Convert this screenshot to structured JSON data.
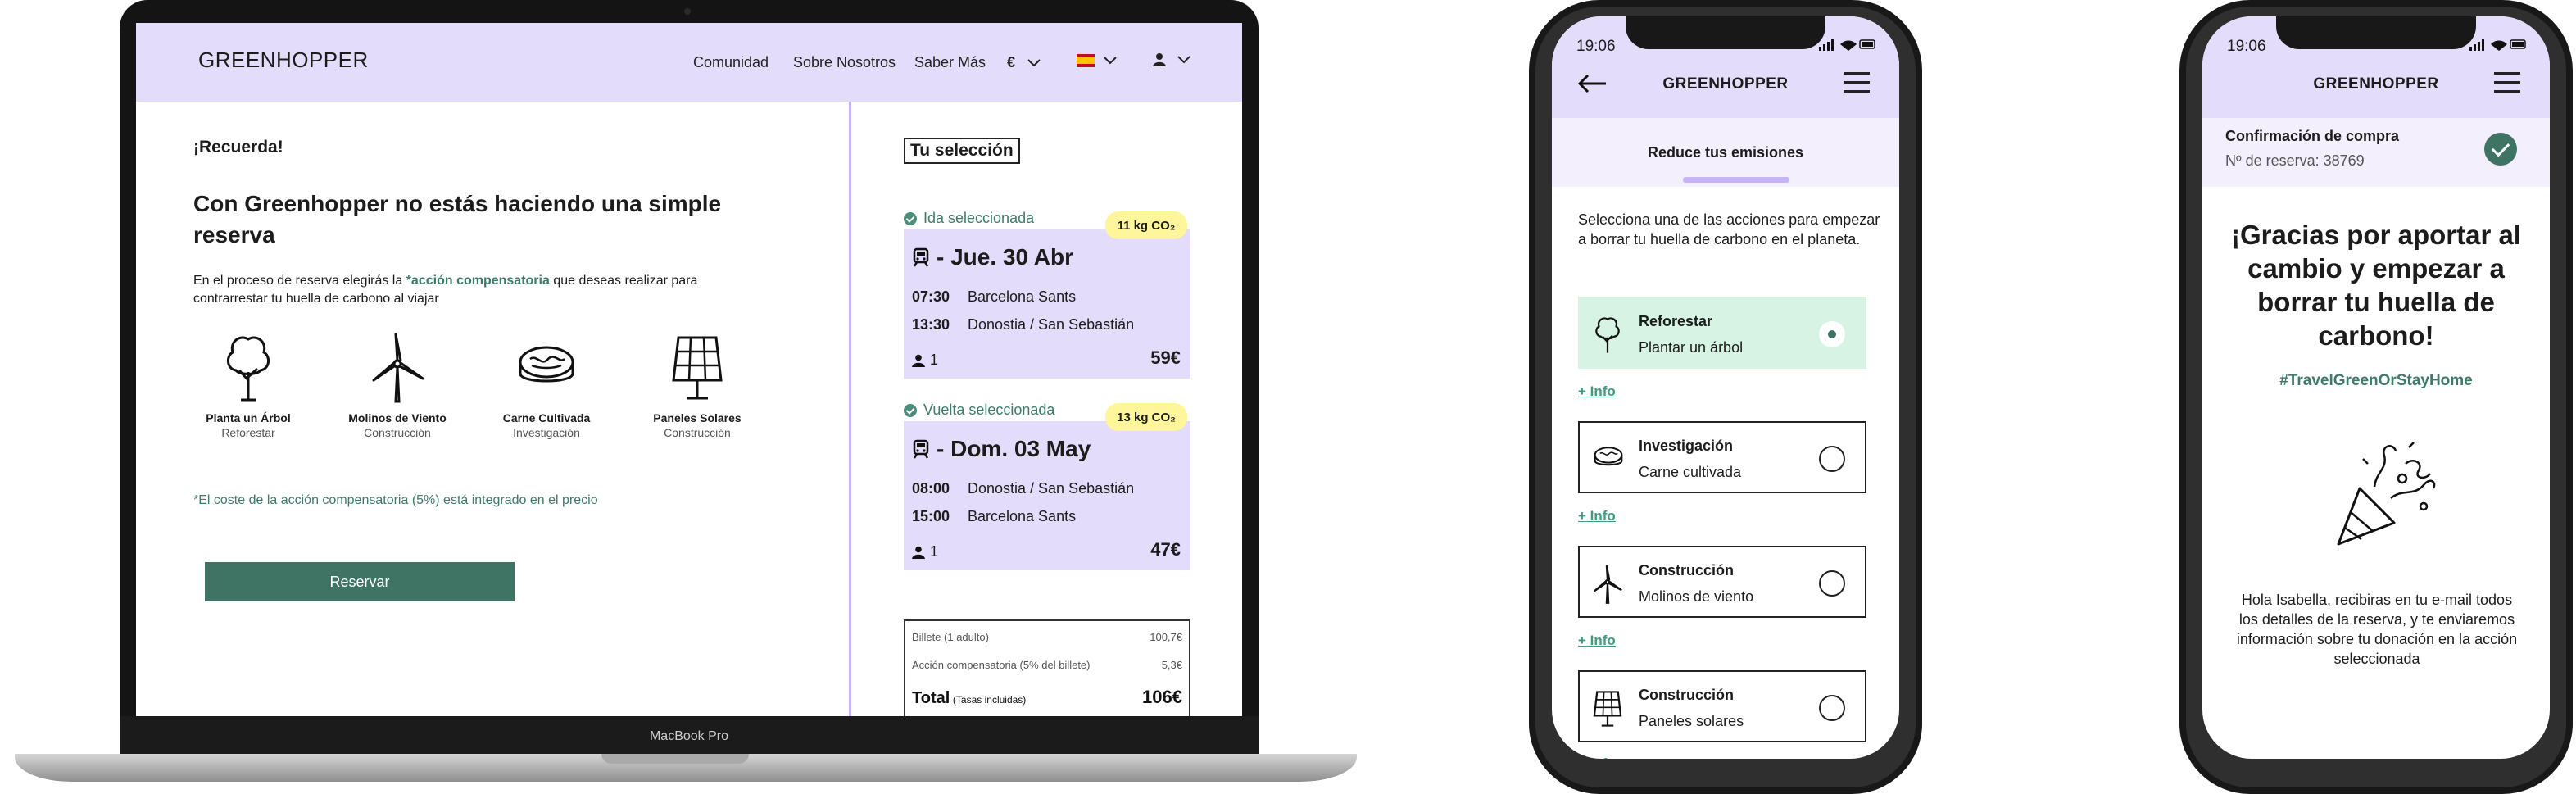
{
  "laptop": {
    "device_label": "MacBook Pro",
    "header": {
      "logo": "GREENHOPPER",
      "nav": [
        "Comunidad",
        "Sobre Nosotros",
        "Saber Más"
      ],
      "currency": "€"
    },
    "main": {
      "reminder": "¡Recuerda!",
      "title": "Con Greenhopper no estás haciendo una simple reserva",
      "desc_before": "En el proceso de reserva elegirás la ",
      "desc_link": "*acción compensatoria",
      "desc_after": " que deseas realizar para contrarrestar tu huella de carbono al viajar",
      "actions": [
        {
          "title": "Planta un Árbol",
          "subtitle": "Reforestar",
          "icon": "tree-icon"
        },
        {
          "title": "Molinos de Viento",
          "subtitle": "Construcción",
          "icon": "windmill-icon"
        },
        {
          "title": "Carne Cultivada",
          "subtitle": "Investigación",
          "icon": "meat-icon"
        },
        {
          "title": "Paneles Solares",
          "subtitle": "Construcción",
          "icon": "solar-panel-icon"
        }
      ],
      "note": "*El coste de la acción compensatoria (5%) está integrado en el precio",
      "reserve_button": "Reservar"
    },
    "sidebar": {
      "title": "Tu selección",
      "outbound": {
        "label": "Ida seleccionada",
        "co2": "11 kg CO₂",
        "date": "- Jue. 30 Abr",
        "rows": [
          {
            "time": "07:30",
            "place": "Barcelona Sants"
          },
          {
            "time": "13:30",
            "place": "Donostia / San Sebastián"
          }
        ],
        "passengers": "1",
        "price": "59€"
      },
      "return": {
        "label": "Vuelta seleccionada",
        "co2": "13 kg CO₂",
        "date": "- Dom. 03 May",
        "rows": [
          {
            "time": "08:00",
            "place": "Donostia / San Sebastián"
          },
          {
            "time": "15:00",
            "place": "Barcelona Sants"
          }
        ],
        "passengers": "1",
        "price": "47€"
      },
      "summary": {
        "ticket_label": "Billete (1 adulto)",
        "ticket_value": "100,7€",
        "comp_label": "Acción compensatoria (5% del billete)",
        "comp_value": "5,3€",
        "total_label": "Total",
        "total_note": "(Tasas incluidas)",
        "total_value": "106€"
      }
    }
  },
  "phone1": {
    "time": "19:06",
    "logo": "GREENHOPPER",
    "subtitle": "Reduce tus emisiones",
    "intro": "Selecciona una de las acciones para empezar a borrar tu huella de carbono en el planeta.",
    "options": [
      {
        "title": "Reforestar",
        "subtitle": "Plantar un árbol",
        "icon": "tree-icon",
        "selected": true
      },
      {
        "title": "Investigación",
        "subtitle": "Carne cultivada",
        "icon": "meat-icon",
        "selected": false
      },
      {
        "title": "Construcción",
        "subtitle": "Molinos de viento",
        "icon": "windmill-icon",
        "selected": false
      },
      {
        "title": "Construcción",
        "subtitle": "Paneles solares",
        "icon": "solar-panel-icon",
        "selected": false
      }
    ],
    "info_link": "+ Info"
  },
  "phone2": {
    "time": "19:06",
    "logo": "GREENHOPPER",
    "confirmation_title": "Confirmación de compra",
    "reservation": "Nº de reserva: 38769",
    "thanks": "¡Gracias por aportar al cambio y empezar a borrar tu huella de carbono!",
    "hashtag": "#TravelGreenOrStayHome",
    "message": "Hola Isabella,  recibiras en tu e-mail todos los detalles de la reserva, y te enviaremos información sobre tu donación en la acción seleccionada"
  },
  "colors": {
    "lavender": "#e4dcfb",
    "green": "#3f7465",
    "mint": "#d6f3e3",
    "co2_badge": "#fff59b"
  }
}
